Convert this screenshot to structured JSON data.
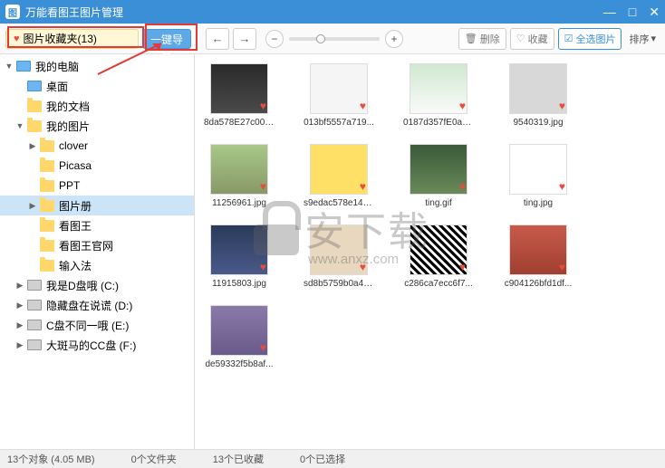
{
  "titlebar": {
    "title": "万能看图王图片管理"
  },
  "toolbar": {
    "favorites_label": "图片收藏夹(13)",
    "export_label": "一键导出",
    "delete_label": "删除",
    "favorite_btn": "收藏",
    "select_all": "全选图片",
    "sort_label": "排序"
  },
  "sidebar": {
    "items": [
      {
        "label": "我的电脑",
        "icon": "monitor",
        "arrow": "▼",
        "indent": 0
      },
      {
        "label": "桌面",
        "icon": "monitor",
        "arrow": "",
        "indent": 1
      },
      {
        "label": "我的文档",
        "icon": "folder",
        "arrow": "",
        "indent": 1
      },
      {
        "label": "我的图片",
        "icon": "folder",
        "arrow": "▼",
        "indent": 1
      },
      {
        "label": "clover",
        "icon": "folder",
        "arrow": "▶",
        "indent": 2
      },
      {
        "label": "Picasa",
        "icon": "folder",
        "arrow": "",
        "indent": 2
      },
      {
        "label": "PPT",
        "icon": "folder",
        "arrow": "",
        "indent": 2
      },
      {
        "label": "图片册",
        "icon": "folder",
        "arrow": "▶",
        "indent": 2,
        "selected": true
      },
      {
        "label": "看图王",
        "icon": "folder",
        "arrow": "",
        "indent": 2
      },
      {
        "label": "看图王官网",
        "icon": "folder",
        "arrow": "",
        "indent": 2
      },
      {
        "label": "输入法",
        "icon": "folder",
        "arrow": "",
        "indent": 2
      },
      {
        "label": "我是D盘哦 (C:)",
        "icon": "drive",
        "arrow": "▶",
        "indent": 1
      },
      {
        "label": "隐藏盘在说谎 (D:)",
        "icon": "drive",
        "arrow": "▶",
        "indent": 1
      },
      {
        "label": "C盘不同一哦 (E:)",
        "icon": "drive",
        "arrow": "▶",
        "indent": 1
      },
      {
        "label": "大斑马的CC盘 (F:)",
        "icon": "drive",
        "arrow": "▶",
        "indent": 1
      }
    ]
  },
  "grid": {
    "items": [
      {
        "label": "8da578E27c00b...",
        "cls": "t1"
      },
      {
        "label": "013bf5557a719...",
        "cls": "t2"
      },
      {
        "label": "0187d357fE0ad...",
        "cls": "t3"
      },
      {
        "label": "9540319.jpg",
        "cls": "t4"
      },
      {
        "label": "11256961.jpg",
        "cls": "t5"
      },
      {
        "label": "s9edac578e144...",
        "cls": "t6"
      },
      {
        "label": "ting.gif",
        "cls": "t7"
      },
      {
        "label": "ting.jpg",
        "cls": "t8"
      },
      {
        "label": "11915803.jpg",
        "cls": "t9"
      },
      {
        "label": "sd8b5759b0a46...",
        "cls": "t10"
      },
      {
        "label": "c286ca7ecc6f7...",
        "cls": "t11"
      },
      {
        "label": "c904126bfd1df...",
        "cls": "t12"
      },
      {
        "label": "de59332f5b8af...",
        "cls": "t13"
      }
    ]
  },
  "statusbar": {
    "count": "13个对象 (4.05 MB)",
    "folders": "0个文件夹",
    "favorited": "13个已收藏",
    "selected": "0个已选择"
  },
  "watermark": {
    "text": "安下载",
    "url": "www.anxz.com"
  }
}
